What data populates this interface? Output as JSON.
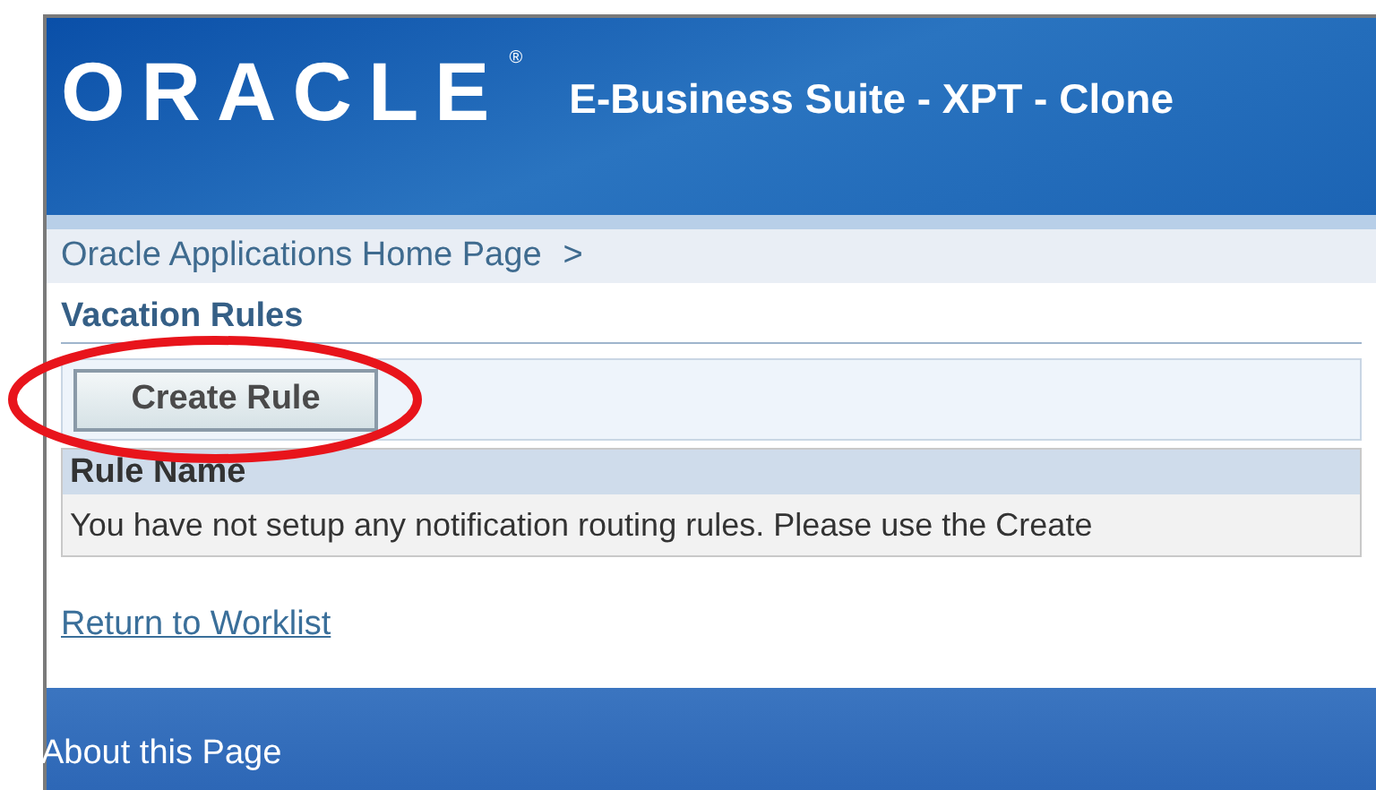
{
  "header": {
    "logo": "ORACLE",
    "logo_mark": "®",
    "title": "E-Business Suite - XPT - Clone"
  },
  "breadcrumb": {
    "link": "Oracle Applications Home Page",
    "separator": ">"
  },
  "page_title": "Vacation Rules",
  "create_button": "Create Rule",
  "table": {
    "columns": [
      "Rule Name"
    ],
    "empty_message": "You have not setup any notification routing rules. Please use the Create"
  },
  "return_link": "Return to Worklist",
  "footer": {
    "link": "About this Page"
  }
}
